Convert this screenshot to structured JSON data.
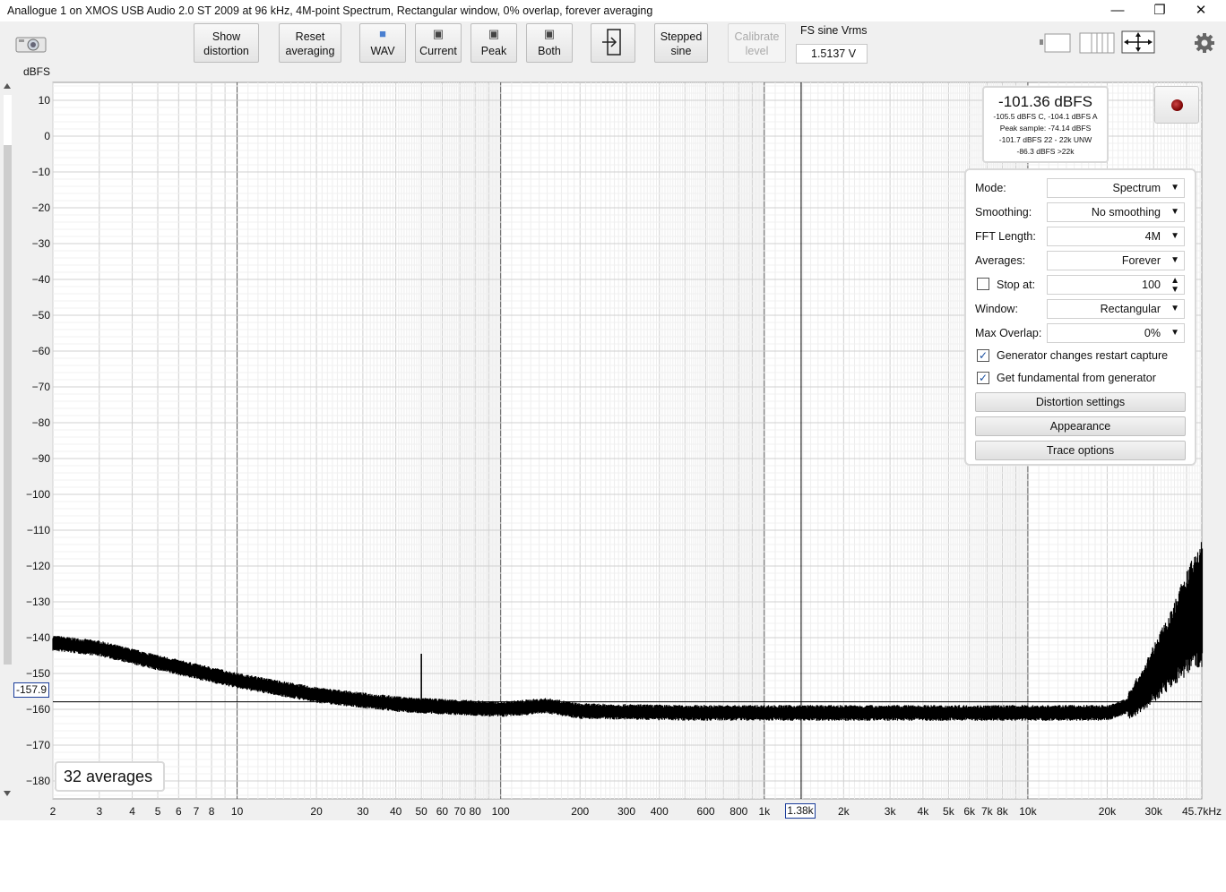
{
  "window": {
    "title": "Anallogue 1 on XMOS USB Audio 2.0 ST 2009 at 96 kHz, 4M-point Spectrum, Rectangular window, 0% overlap, forever averaging",
    "minimize_icon": "minimize-icon",
    "restore_icon": "restore-icon",
    "close_icon": "close-icon"
  },
  "toolbar": {
    "show_distortion": [
      "Show",
      "distortion"
    ],
    "reset_averaging": [
      "Reset",
      "averaging"
    ],
    "wav": "WAV",
    "current": "Current",
    "peak": "Peak",
    "both": "Both",
    "stepped_sine": [
      "Stepped",
      "sine"
    ],
    "calibrate_level": [
      "Calibrate",
      "level"
    ],
    "fs_sine_label": "FS sine Vrms",
    "fs_sine_value": "1.5137 V"
  },
  "plot": {
    "y_unit": "dBFS",
    "y_ticks": [
      "10",
      "0",
      "-10",
      "-20",
      "-30",
      "-40",
      "-50",
      "-60",
      "-70",
      "-80",
      "-90",
      "-100",
      "-110",
      "-120",
      "-130",
      "-140",
      "-150",
      "-160",
      "-170",
      "-180"
    ],
    "x_ticks": [
      "2",
      "3",
      "4",
      "5",
      "6",
      "7",
      "8",
      "10",
      "20",
      "30",
      "40",
      "50",
      "60",
      "70",
      "80",
      "100",
      "200",
      "300",
      "400",
      "600",
      "800",
      "1k",
      "2k",
      "3k",
      "4k",
      "5k",
      "6k",
      "7k",
      "8k",
      "10k",
      "20k",
      "30k",
      "45.7kHz"
    ],
    "cursor_y_label": "-157.9",
    "cursor_x_label": "1.38k",
    "averages_label": "32 averages"
  },
  "readout": {
    "main": "-101.36 dBFS",
    "line1": "-105.5 dBFS C, -104.1 dBFS A",
    "line2": "Peak sample: -74.14 dBFS",
    "line3": "-101.7 dBFS 22 - 22k UNW",
    "line4": "-86.3 dBFS >22k"
  },
  "panel": {
    "mode_label": "Mode:",
    "mode_value": "Spectrum",
    "smoothing_label": "Smoothing:",
    "smoothing_value": "No smoothing",
    "fft_label": "FFT Length:",
    "fft_value": "4M",
    "averages_label": "Averages:",
    "averages_value": "Forever",
    "stop_label": "Stop at:",
    "stop_value": "100",
    "window_label": "Window:",
    "window_value": "Rectangular",
    "overlap_label": "Max Overlap:",
    "overlap_value": "0%",
    "gen_restart_label": "Generator changes restart capture",
    "gen_fund_label": "Get fundamental from generator",
    "distortion_settings": "Distortion settings",
    "appearance": "Appearance",
    "trace_options": "Trace options"
  },
  "chart_data": {
    "type": "line",
    "xscale": "log",
    "xlim": [
      2,
      45700
    ],
    "ylim": [
      -185,
      15
    ],
    "ylabel": "dBFS",
    "cursor": {
      "x": 1380,
      "y": -157.9
    },
    "series": [
      {
        "color": "#000000",
        "x": [
          2,
          3,
          5,
          10,
          20,
          30,
          40,
          50,
          100,
          150,
          200,
          500,
          1000,
          2000,
          5000,
          10000,
          20000,
          24000,
          27000,
          30000,
          35000,
          40000,
          45700
        ],
        "y": [
          -141.5,
          -143,
          -147,
          -152,
          -156,
          -157.5,
          -158.5,
          -159,
          -160,
          -159,
          -160.5,
          -161,
          -161,
          -161,
          -161,
          -161,
          -161,
          -159,
          -155,
          -150,
          -143,
          -136,
          -130
        ]
      }
    ],
    "peaks": [
      {
        "x": 50,
        "y": -144.5
      }
    ]
  }
}
